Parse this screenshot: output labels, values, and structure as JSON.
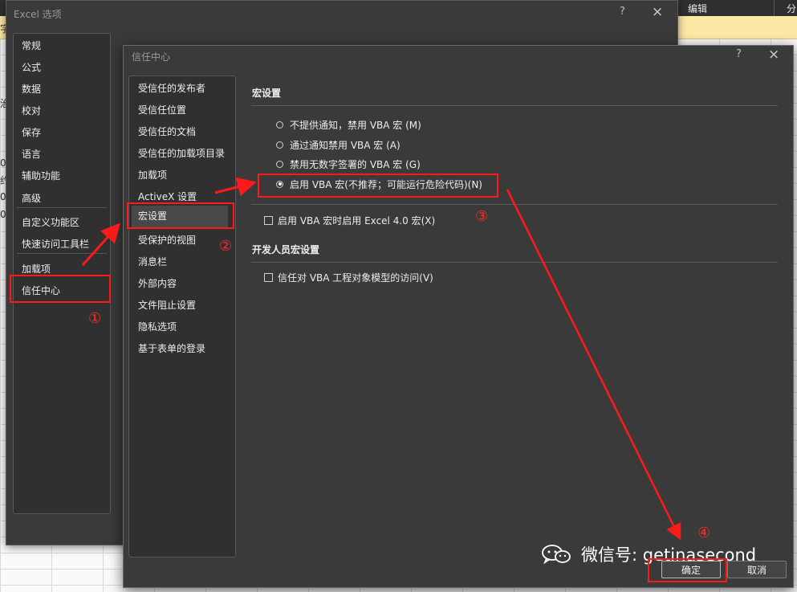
{
  "excel_background": {
    "ribbon_labels": [
      "编辑",
      "分"
    ],
    "left_fragments": [
      "字",
      "治",
      "0",
      "约",
      "0",
      "0"
    ]
  },
  "excel_options": {
    "title": "Excel 选项",
    "help_icon": "?",
    "close_icon": "×",
    "nav_items": [
      "常规",
      "公式",
      "数据",
      "校对",
      "保存",
      "语言",
      "辅助功能",
      "高级",
      "自定义功能区",
      "快速访问工具栏",
      "加载项",
      "信任中心"
    ],
    "selected": "信任中心"
  },
  "trust_center": {
    "title": "信任中心",
    "help_icon": "?",
    "close_icon": "×",
    "nav_items": [
      "受信任的发布者",
      "受信任位置",
      "受信任的文档",
      "受信任的加载项目录",
      "加载项",
      "ActiveX 设置",
      "宏设置",
      "受保护的视图",
      "消息栏",
      "外部内容",
      "文件阻止设置",
      "隐私选项",
      "基于表单的登录"
    ],
    "selected": "宏设置",
    "macro_section": {
      "heading": "宏设置",
      "radios": [
        {
          "label": "不提供通知，禁用 VBA 宏 (M)",
          "checked": false
        },
        {
          "label": "通过通知禁用 VBA 宏 (A)",
          "checked": false
        },
        {
          "label": "禁用无数字签署的 VBA 宏 (G)",
          "checked": false
        },
        {
          "label": "启用 VBA 宏(不推荐；可能运行危险代码)(N)",
          "checked": true
        }
      ],
      "excel4_checkbox": {
        "label": "启用 VBA 宏时启用 Excel 4.0 宏(X)",
        "checked": false
      }
    },
    "developer_section": {
      "heading": "开发人员宏设置",
      "checkbox": {
        "label": "信任对 VBA 工程对象模型的访问(V)",
        "checked": false
      }
    },
    "buttons": {
      "ok": "确定",
      "cancel": "取消"
    }
  },
  "watermark": {
    "text": "微信号: getinasecond",
    "icon": "wechat-icon"
  },
  "annotations": {
    "numbers": [
      "①",
      "②",
      "③",
      "④"
    ],
    "color": "#ff1a1a"
  }
}
